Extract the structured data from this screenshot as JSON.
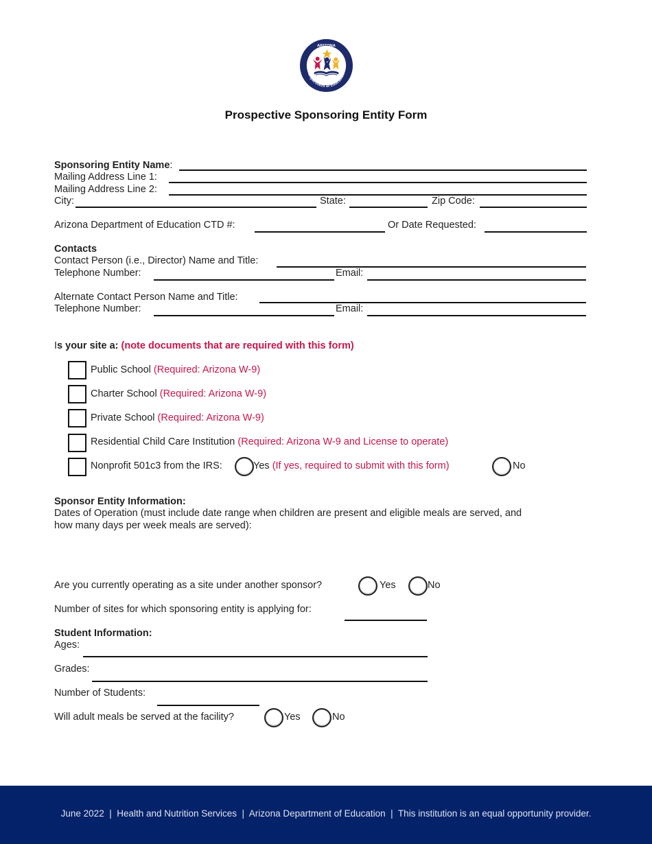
{
  "header": {
    "logo": {
      "name": "arizona-department-of-education-logo",
      "top_text": "ARIZONA",
      "bottom_text": "Department of Education",
      "colors": {
        "ring": "#1d2a6b",
        "red": "#c8174a",
        "yellow": "#f0b323",
        "navy": "#1d2a6b"
      }
    },
    "title": "Prospective Sponsoring Entity Form"
  },
  "entity": {
    "name_label": "Sponsoring Entity Name",
    "name_colon": ":",
    "address1_label": "Mailing Address Line 1:",
    "address2_label": "Mailing Address Line 2:",
    "city_label": "City:",
    "state_label": "State:",
    "zip_label": "Zip Code:",
    "ctd_label": "Arizona Department of Education CTD #:",
    "date_requested_label": "Or Date Requested:"
  },
  "contacts": {
    "heading": "Contacts",
    "contact_name_label": "Contact Person (i.e., Director) Name and Title:",
    "phone_label": "Telephone Number:",
    "email_label": "Email:",
    "alt_contact_name_label": "Alternate Contact Person Name and Title:",
    "alt_phone_label": "Telephone Number:",
    "alt_email_label": "Email:"
  },
  "site_type": {
    "question_prefix": "I",
    "question_bold": "s your site a:",
    "question_note": "(note documents that are required with this form)",
    "options": [
      {
        "label": "Public School",
        "note": "(Required: Arizona W-9)",
        "checked": false
      },
      {
        "label": "Charter School",
        "note": "(Required: Arizona W-9)",
        "checked": false
      },
      {
        "label": "Private School",
        "note": "(Required: Arizona W-9)",
        "checked": false
      },
      {
        "label": "Residential Child Care Institution",
        "note": "(Required: Arizona W-9 and License to operate)",
        "checked": false
      },
      {
        "label": "Nonprofit 501c3 from the IRS:",
        "checked": false
      }
    ],
    "nonprofit_yes_label": "Yes",
    "nonprofit_yes_note": "(If yes, required to submit with this form)",
    "nonprofit_no_label": "No"
  },
  "sponsor_info": {
    "heading": "Sponsor Entity Information:",
    "dates_label_line1": "Dates of Operation (must include date range when children are present and eligible meals are served, and",
    "dates_label_line2": "how many days per week meals are served):",
    "another_sponsor_question": "Are you currently operating as a site under another sponsor?",
    "yes_label": "Yes",
    "no_label": "No",
    "num_sites_label": "Number of sites for which sponsoring entity is applying for:"
  },
  "student_info": {
    "heading": "Student Information:",
    "ages_label": "Ages:",
    "grades_label": "Grades:",
    "num_students_label": "Number of Students:",
    "adult_meals_question": "Will adult meals be served at the facility?",
    "yes_label": "Yes",
    "no_label": "No"
  },
  "footer": {
    "text": "June 2022  |  Health and Nutrition Services  |  Arizona Department of Education  |  This institution is an equal opportunity provider.",
    "background": "#03226a"
  }
}
